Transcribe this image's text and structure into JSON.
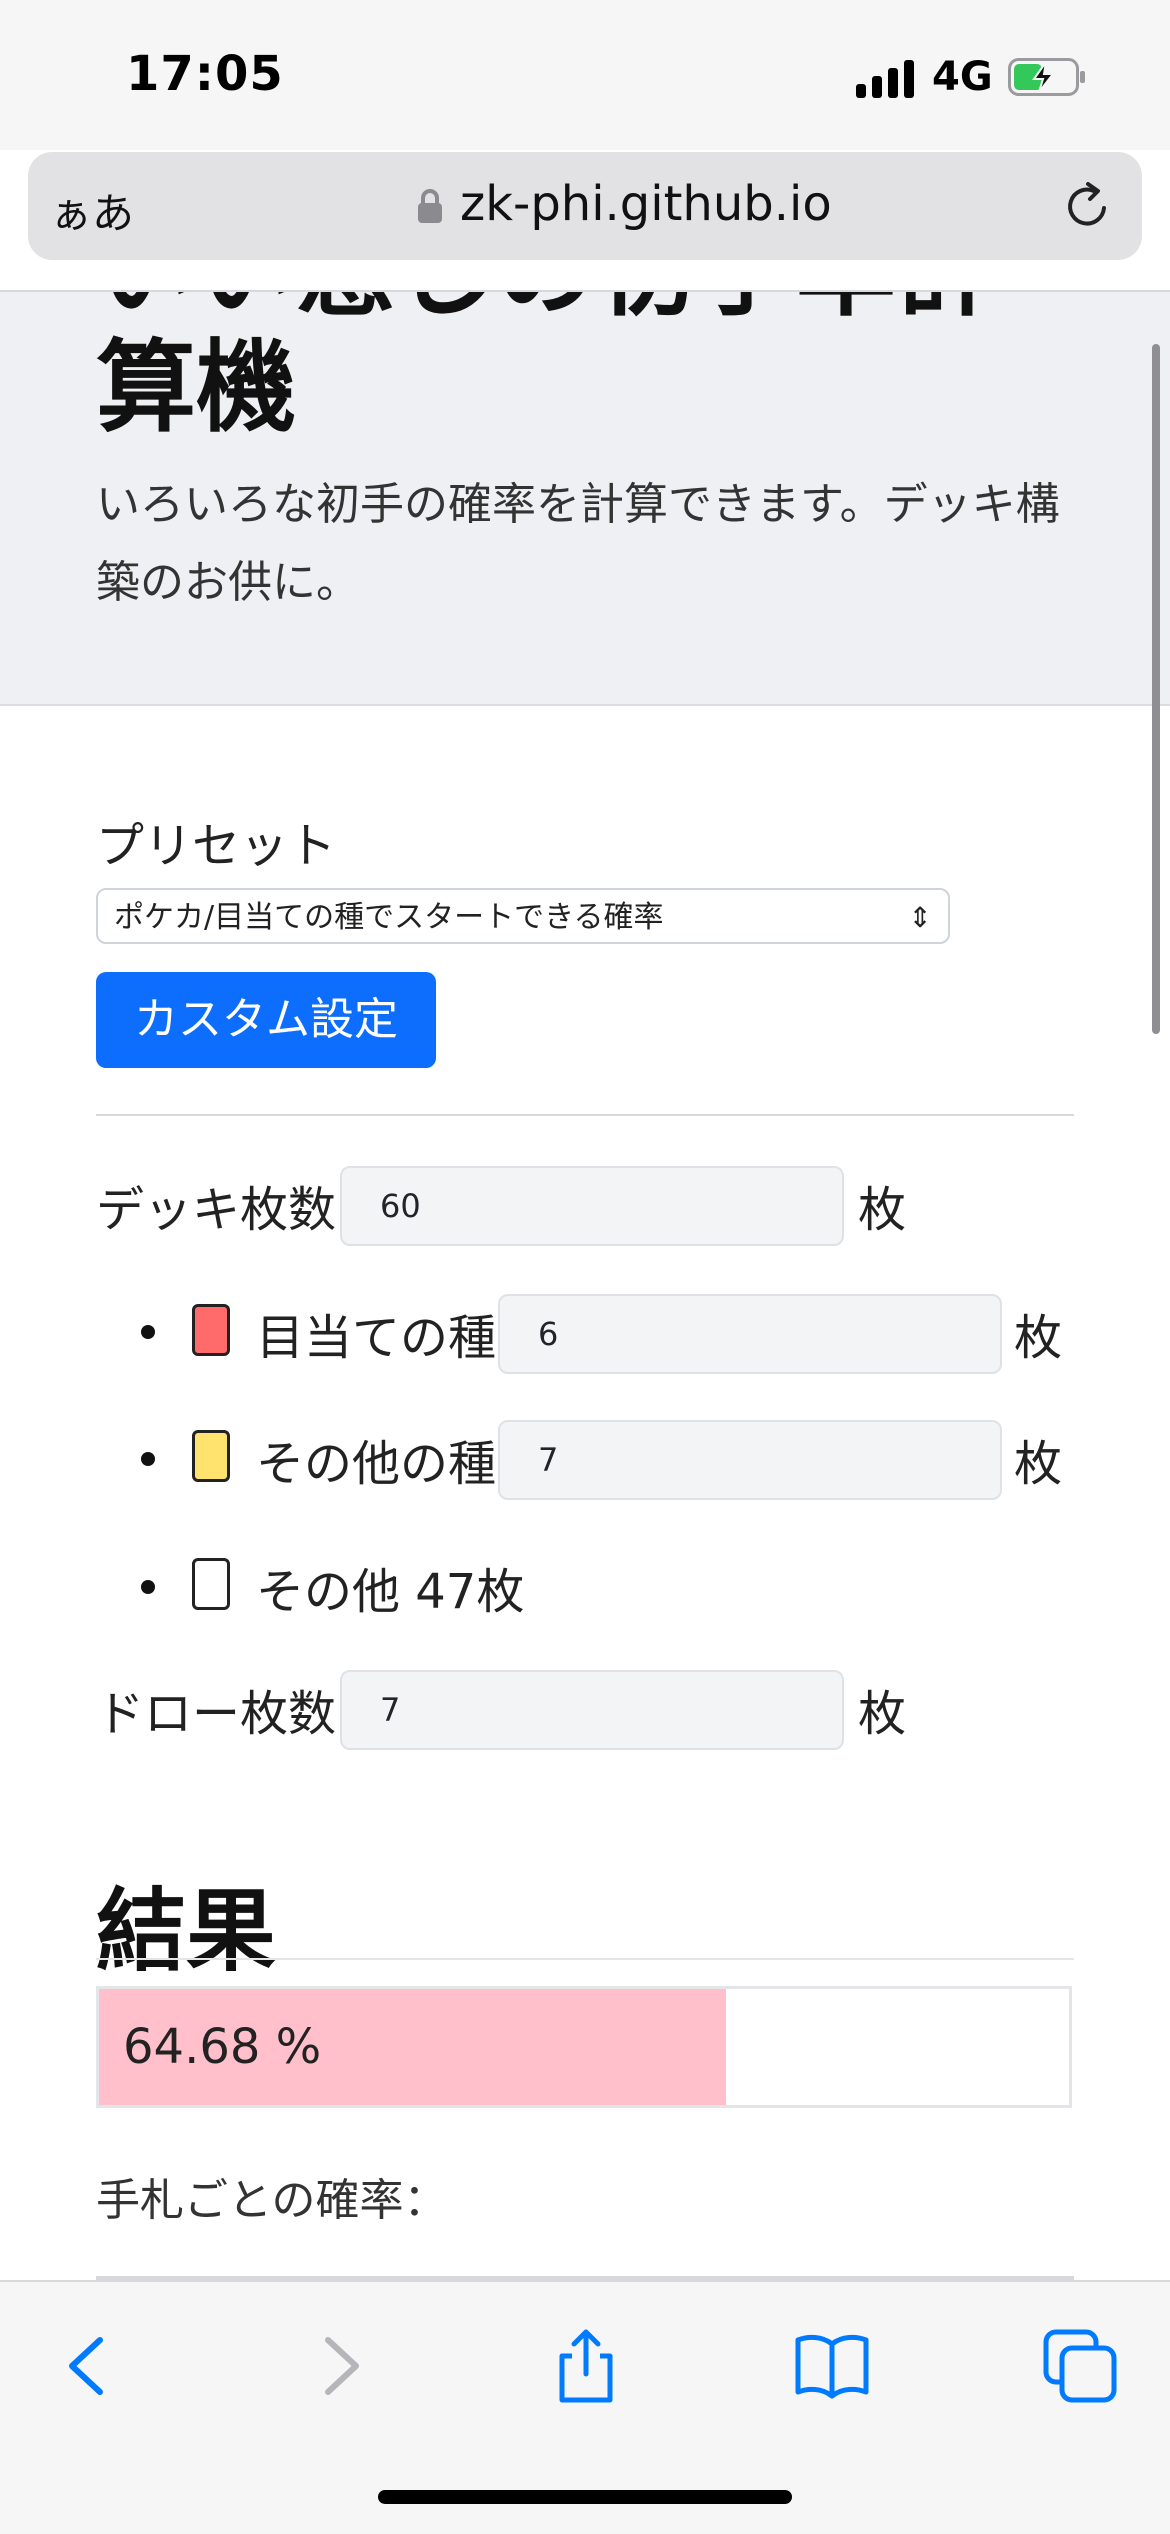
{
  "status_bar": {
    "time": "17:05",
    "network": "4G"
  },
  "browser": {
    "text_size_label": "ぁあ",
    "domain": "zk-phi.github.io"
  },
  "jumbotron": {
    "title_cut": "いい感じの初手率計",
    "title_second_line": "算機",
    "lead": "いろいろな初手の確率を計算できます。デッキ構築のお供に。"
  },
  "preset": {
    "label": "プリセット",
    "selected": "ポケカ/目当ての種でスタートできる確率",
    "custom_button": "カスタム設定"
  },
  "deck": {
    "deck_label": "デッキ枚数",
    "deck_value": "60",
    "unit": "枚",
    "items": [
      {
        "label": "目当ての種",
        "value": "6",
        "color": "#ff6b6b"
      },
      {
        "label": "その他の種",
        "value": "7",
        "color": "#ffe36e"
      },
      {
        "label": "その他 47枚",
        "color": "#ffffff"
      }
    ],
    "draw_label": "ドロー枚数",
    "draw_value": "7"
  },
  "result": {
    "title": "結果",
    "probability_text": "64.68 %",
    "probability_percent": 64.68,
    "bar_color": "#ffc0cb",
    "per_hand_label": "手札ごとの確率："
  },
  "toolbar": {
    "icons": [
      "back-icon",
      "forward-icon",
      "share-icon",
      "bookmarks-icon",
      "tabs-icon"
    ],
    "accent": "#007aff"
  }
}
